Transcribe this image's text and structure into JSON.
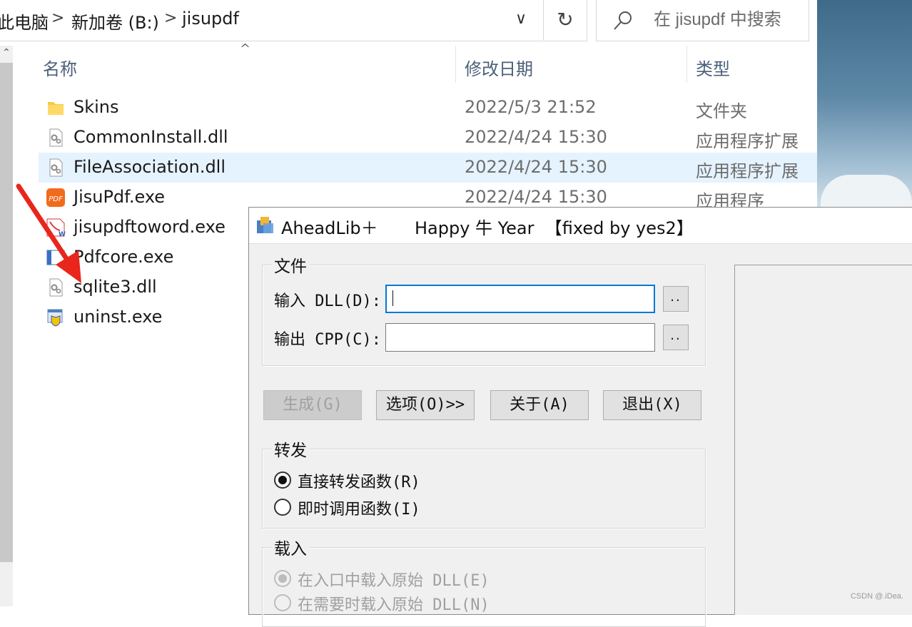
{
  "explorer": {
    "breadcrumb": [
      "此电脑",
      "新加卷 (B:)",
      "jisupdf"
    ],
    "breadcrumb_sep": ">",
    "address_dropdown_glyph": "∨",
    "refresh_glyph": "↻",
    "search_placeholder": "在 jisupdf 中搜索",
    "columns": {
      "name": "名称",
      "modified": "修改日期",
      "type": "类型"
    },
    "sort_glyph": "^",
    "files": [
      {
        "name": "Skins",
        "date": "2022/5/3 21:52",
        "type": "文件夹",
        "icon": "folder-icon",
        "selected": false
      },
      {
        "name": "CommonInstall.dll",
        "date": "2022/4/24 15:30",
        "type": "应用程序扩展",
        "icon": "dll-file-icon",
        "selected": false
      },
      {
        "name": "FileAssociation.dll",
        "date": "2022/4/24 15:30",
        "type": "应用程序扩展",
        "icon": "dll-file-icon",
        "selected": true
      },
      {
        "name": "JisuPdf.exe",
        "date": "2022/4/24 15:30",
        "type": "应用程序",
        "icon": "jisupdf-app-icon",
        "selected": false
      },
      {
        "name": "jisupdftoword.exe",
        "date": "",
        "type": "",
        "icon": "pdf-to-word-app-icon",
        "selected": false
      },
      {
        "name": "Pdfcore.exe",
        "date": "",
        "type": "",
        "icon": "pdfcore-app-icon",
        "selected": false
      },
      {
        "name": "sqlite3.dll",
        "date": "",
        "type": "",
        "icon": "dll-file-icon",
        "selected": false
      },
      {
        "name": "uninst.exe",
        "date": "",
        "type": "",
        "icon": "uninstaller-icon",
        "selected": false
      }
    ]
  },
  "dialog": {
    "title": "AheadLib＋",
    "title_suffix": "Happy 牛 Year  【fixed by yes2】",
    "file_group": {
      "label": "文件",
      "input_label": "输入 DLL(D):",
      "input_value": "",
      "output_label": "输出 CPP(C):",
      "output_value": "",
      "browse_label": ".."
    },
    "buttons": {
      "generate": "生成(G)",
      "options": "选项(O)>>",
      "about": "关于(A)",
      "exit": "退出(X)"
    },
    "forward_group": {
      "label": "转发",
      "direct": "直接转发函数(R)",
      "direct_checked": true,
      "immediate": "即时调用函数(I)",
      "immediate_checked": false
    },
    "load_group": {
      "label": "载入",
      "at_entry": "在入口中载入原始 DLL(E)",
      "at_entry_checked": true,
      "on_demand": "在需要时载入原始 DLL(N)",
      "on_demand_checked": false
    }
  },
  "watermark": "CSDN @.iDea.",
  "colors": {
    "selection": "#e5f3ff",
    "accent": "#0078d7",
    "arrow": "#e8261c",
    "dialog_bg": "#f0f0f0"
  }
}
